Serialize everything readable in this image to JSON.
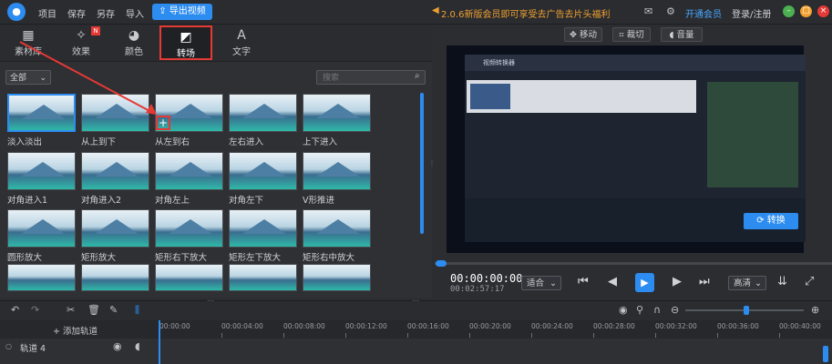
{
  "titlebar": {
    "menu": [
      "项目",
      "保存",
      "另存",
      "导入"
    ],
    "export_label": "导出视频",
    "promo": "2.0.6新版会员即可享受去广告去片头福利",
    "vip": "开通会员",
    "login": "登录/注册"
  },
  "tabs": [
    {
      "label": "素材库",
      "icon": "media-library-icon"
    },
    {
      "label": "效果",
      "icon": "effects-icon",
      "badge": "N"
    },
    {
      "label": "颜色",
      "icon": "palette-icon"
    },
    {
      "label": "转场",
      "icon": "transition-icon"
    },
    {
      "label": "文字",
      "icon": "text-icon"
    }
  ],
  "filter": {
    "selected": "全部"
  },
  "search": {
    "placeholder": "搜索"
  },
  "transitions": [
    "淡入淡出",
    "从上到下",
    "从左到右",
    "左右进入",
    "上下进入",
    "对角进入1",
    "对角进入2",
    "对角左上",
    "对角左下",
    "V形推进",
    "圆形放大",
    "矩形放大",
    "矩形右下放大",
    "矩形左下放大",
    "矩形右中放大"
  ],
  "preview": {
    "move_label": "移动",
    "crop_label": "裁切",
    "volume_label": "音量",
    "embedded_app": {
      "title": "视频转换器",
      "convert_label": "转换"
    }
  },
  "player": {
    "timecode": "00:00:00:00",
    "duration": "00:02:57:17",
    "fit": "适合",
    "quality": "高清"
  },
  "timeline": {
    "add_track": "添加轨道",
    "track_name": "轨道 4",
    "ticks": [
      "00:00:00",
      "00:00:04:00",
      "00:00:08:00",
      "00:00:12:00",
      "00:00:16:00",
      "00:00:20:00",
      "00:00:24:00",
      "00:00:28:00",
      "00:00:32:00",
      "00:00:36:00",
      "00:00:40:00"
    ]
  },
  "colors": {
    "accent": "#2d8cf0",
    "highlight": "#e53935",
    "promo": "#f0a030"
  }
}
